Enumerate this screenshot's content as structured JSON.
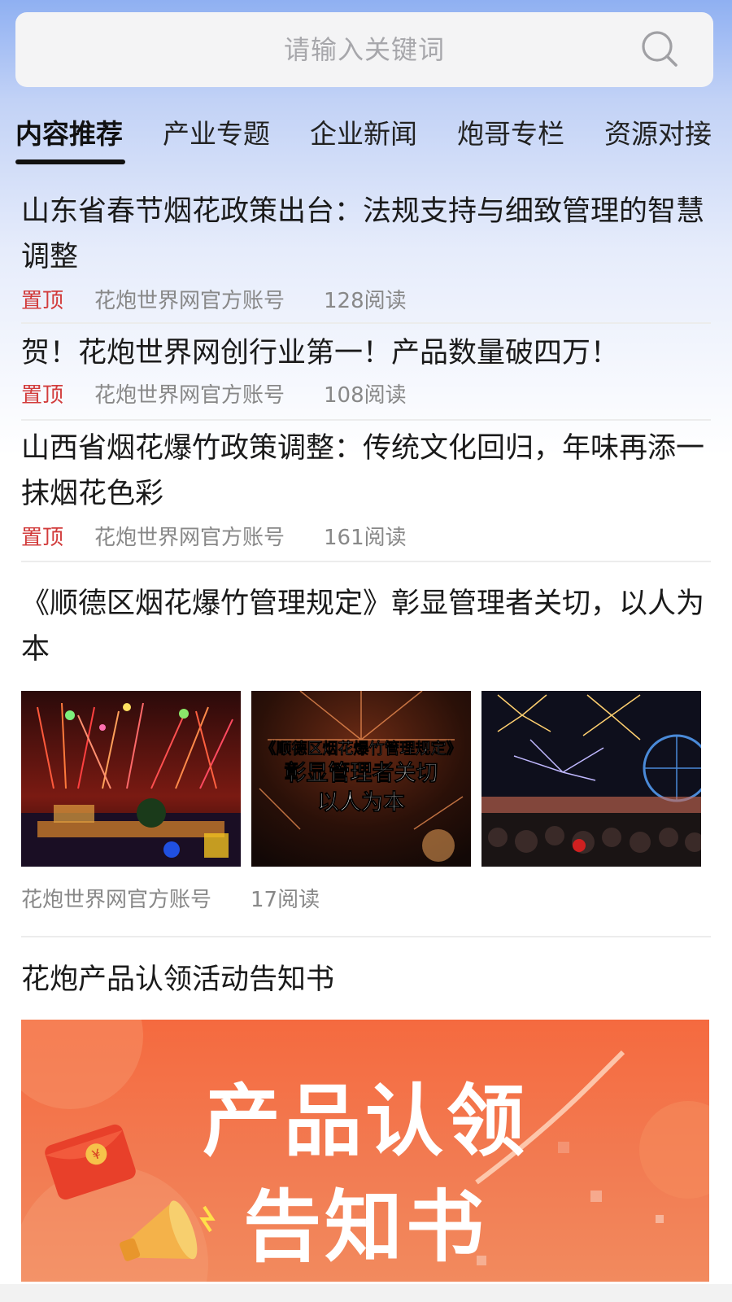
{
  "search": {
    "placeholder": "请输入关键词"
  },
  "tabs": [
    {
      "label": "内容推荐",
      "active": true
    },
    {
      "label": "产业专题",
      "active": false
    },
    {
      "label": "企业新闻",
      "active": false
    },
    {
      "label": "炮哥专栏",
      "active": false
    },
    {
      "label": "资源对接",
      "active": false
    }
  ],
  "articles": [
    {
      "title": "山东省春节烟花政策出台：法规支持与细致管理的智慧调整",
      "pin": "置顶",
      "author": "花炮世界网官方账号",
      "reads": "128阅读"
    },
    {
      "title": "贺！花炮世界网创行业第一！产品数量破四万！",
      "pin": "置顶",
      "author": "花炮世界网官方账号",
      "reads": "108阅读"
    },
    {
      "title": "山西省烟花爆竹政策调整：传统文化回归，年味再添一抹烟花色彩",
      "pin": "置顶",
      "author": "花炮世界网官方账号",
      "reads": "161阅读"
    },
    {
      "title": "《顺德区烟花爆竹管理规定》彰显管理者关切，以人为本",
      "author": "花炮世界网官方账号",
      "reads": "17阅读",
      "thumb_text": {
        "line1": "《顺德区烟花爆竹管理规定》",
        "line2": "彰显管理者关切",
        "line3": "以人为本"
      }
    },
    {
      "title": "花炮产品认领活动告知书",
      "banner_text": {
        "line1": "产品认领",
        "line2": "告知书"
      }
    }
  ],
  "colors": {
    "pin": "#d23c3c",
    "meta": "#888888",
    "banner": "#f56a3f"
  },
  "icons": {
    "search": "search-icon",
    "megaphone": "megaphone-icon",
    "red_packet": "red-packet-icon"
  }
}
